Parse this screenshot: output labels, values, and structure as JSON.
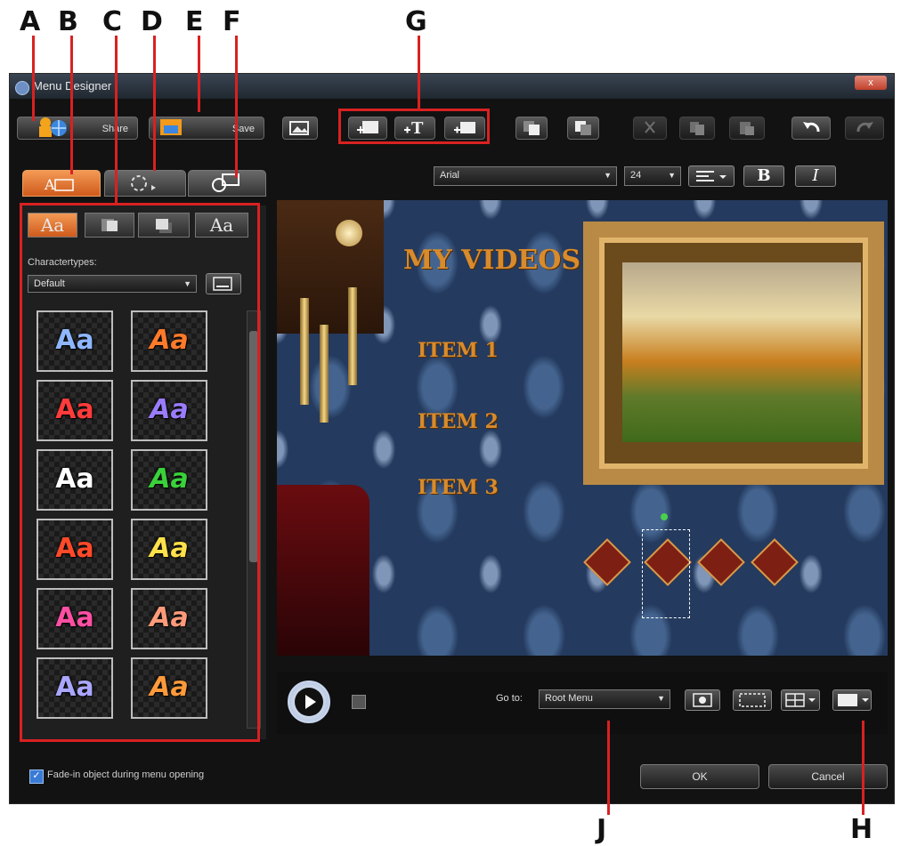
{
  "callouts": [
    "A",
    "B",
    "C",
    "D",
    "E",
    "F",
    "G",
    "H",
    "J"
  ],
  "window": {
    "title": "Menu Designer",
    "close_glyph": "x"
  },
  "toolbar": {
    "share_label": "Share",
    "save_label": "Save",
    "icons": [
      "image-icon",
      "add-image-icon",
      "add-text-icon",
      "add-button-icon",
      "bring-forward-icon",
      "send-backward-icon",
      "cut-icon",
      "copy-icon",
      "paste-icon",
      "undo-icon",
      "redo-icon"
    ]
  },
  "font_bar": {
    "font": "Arial",
    "size": "24",
    "bold": "B",
    "italic": "I"
  },
  "left_panel": {
    "subtabs": [
      "Aa",
      "Aa"
    ],
    "character_types_label": "Charactertypes:",
    "character_type_value": "Default",
    "swatch_text": "Aa",
    "swatch_colors": [
      "#8fb7ff",
      "#ff7a2a",
      "#ff3b3b",
      "#9a7cff",
      "#ffffff",
      "#3ad13a",
      "#ff4a2a",
      "#ffe14a",
      "#ff4fa3",
      "#ff9a7a",
      "#aaa6ff",
      "#ff9a3a"
    ]
  },
  "preview": {
    "title": "MY VIDEOS",
    "items": [
      "ITEM 1",
      "ITEM 2",
      "ITEM 3"
    ]
  },
  "bottom_bar": {
    "goto_label": "Go to:",
    "goto_value": "Root Menu"
  },
  "footer": {
    "fade_checkbox_label": "Fade-in object during menu opening",
    "ok_label": "OK",
    "cancel_label": "Cancel"
  },
  "colors": {
    "accent": "#e5762e",
    "highlight_border": "#d92121"
  }
}
